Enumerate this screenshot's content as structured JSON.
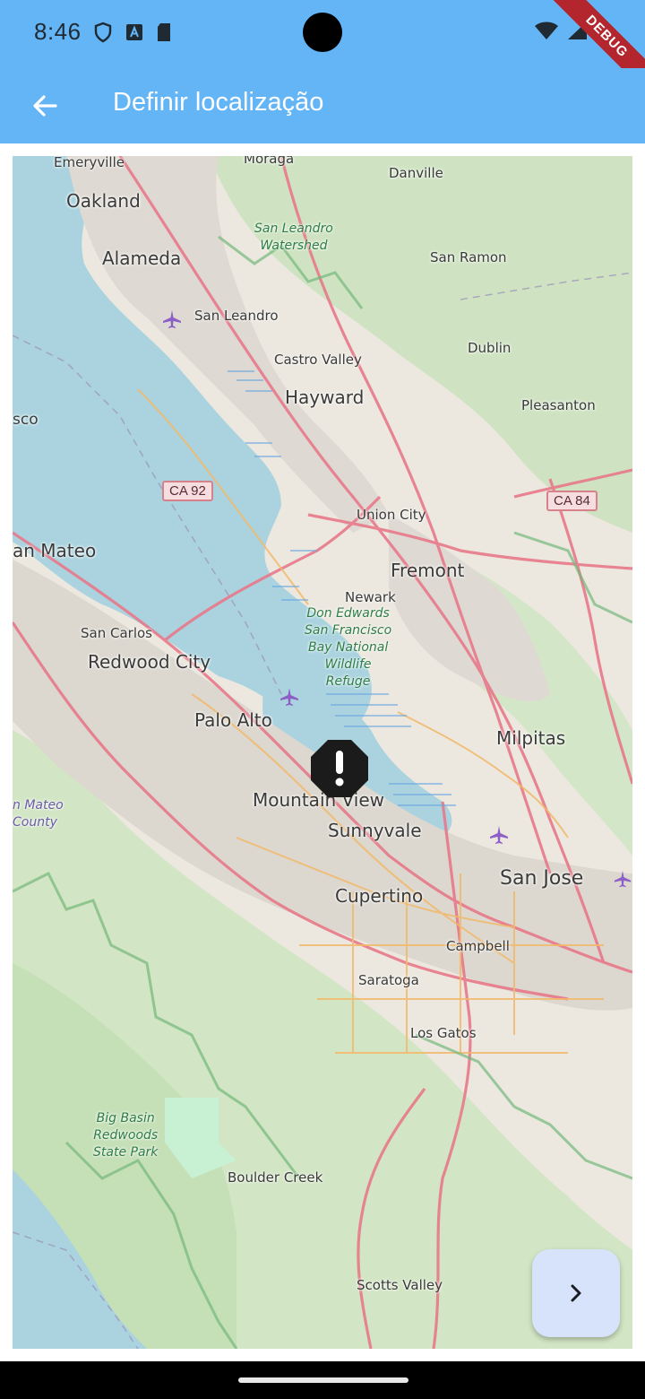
{
  "status_bar": {
    "time": "8:46",
    "icons_left": [
      "shield-icon",
      "a-badge-icon",
      "sd-card-icon"
    ],
    "icons_right": [
      "wifi-icon",
      "signal-icon",
      "battery-icon"
    ],
    "debug_label": "DEBUG"
  },
  "app_bar": {
    "back_icon": "arrow-back-icon",
    "title": "Definir localização",
    "color": "#64b5f6"
  },
  "map": {
    "labels": {
      "emeryville": "Emeryville",
      "moraga": "Moraga",
      "danville": "Danville",
      "oakland": "Oakland",
      "san_leandro_watershed": "San Leandro\nWatershed",
      "alameda": "Alameda",
      "san_ramon": "San Ramon",
      "san_leandro": "San Leandro",
      "dublin": "Dublin",
      "castro_valley": "Castro Valley",
      "hayward": "Hayward",
      "pleasanton": "Pleasanton",
      "sco": "sco",
      "ca92": "CA 92",
      "ca84": "CA 84",
      "union_city": "Union City",
      "san_mateo": "an Mateo",
      "fremont": "Fremont",
      "newark": "Newark",
      "don_edwards": "Don Edwards\nSan Francisco\nBay National\nWildlife\nRefuge",
      "san_carlos": "San Carlos",
      "redwood_city": "Redwood City",
      "palo_alto": "Palo Alto",
      "milpitas": "Milpitas",
      "mountain_view": "Mountain View",
      "san_mateo_county": "n Mateo\nCounty",
      "sunnyvale": "Sunnyvale",
      "san_jose": "San Jose",
      "cupertino": "Cupertino",
      "campbell": "Campbell",
      "saratoga": "Saratoga",
      "los_gatos": "Los Gatos",
      "big_basin": "Big Basin\nRedwoods\nState Park",
      "boulder_creek": "Boulder Creek",
      "scotts_valley": "Scotts Valley"
    },
    "marker_icon": "alert-octagon-icon"
  },
  "fab": {
    "icon": "chevron-right-icon",
    "color": "#d6e3fb"
  }
}
